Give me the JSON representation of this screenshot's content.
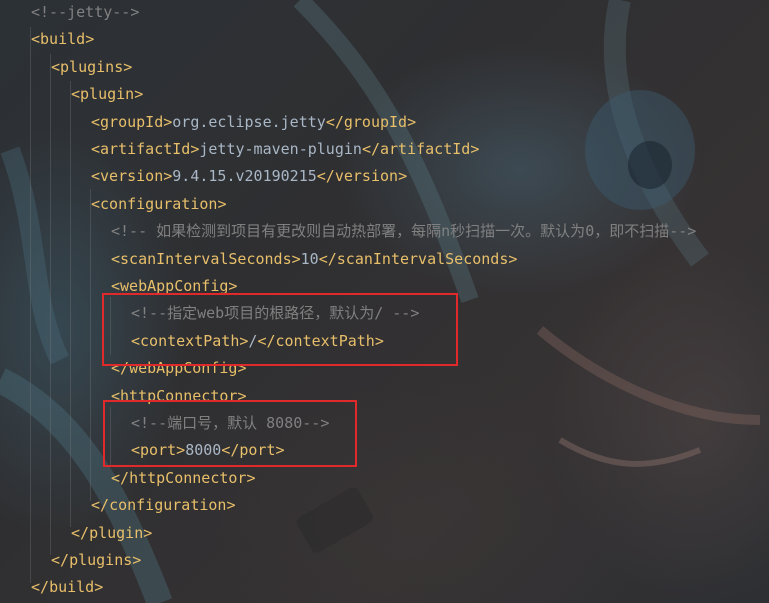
{
  "editor": {
    "lines": [
      {
        "kind": "comment",
        "text": "<!--jetty-->"
      },
      {
        "kind": "open",
        "tag": "build"
      },
      {
        "kind": "open",
        "tag": "plugins"
      },
      {
        "kind": "open",
        "tag": "plugin"
      },
      {
        "kind": "elem",
        "tag": "groupId",
        "value": "org.eclipse.jetty"
      },
      {
        "kind": "elem",
        "tag": "artifactId",
        "value": "jetty-maven-plugin"
      },
      {
        "kind": "elem",
        "tag": "version",
        "value": "9.4.15.v20190215"
      },
      {
        "kind": "open",
        "tag": "configuration"
      },
      {
        "kind": "comment",
        "text": "<!-- 如果检测到项目有更改则自动热部署，每隔n秒扫描一次。默认为0，即不扫描-->"
      },
      {
        "kind": "elem",
        "tag": "scanIntervalSeconds",
        "value": "10"
      },
      {
        "kind": "open",
        "tag": "webAppConfig"
      },
      {
        "kind": "comment",
        "text": "<!--指定web项目的根路径，默认为/ -->"
      },
      {
        "kind": "elem",
        "tag": "contextPath",
        "value": "/"
      },
      {
        "kind": "close",
        "tag": "webAppConfig"
      },
      {
        "kind": "open",
        "tag": "httpConnector"
      },
      {
        "kind": "comment",
        "text": "<!--端口号，默认 8080-->"
      },
      {
        "kind": "elem",
        "tag": "port",
        "value": "8000"
      },
      {
        "kind": "close",
        "tag": "httpConnector"
      },
      {
        "kind": "close",
        "tag": "configuration"
      },
      {
        "kind": "close",
        "tag": "plugin"
      },
      {
        "kind": "close",
        "tag": "plugins"
      },
      {
        "kind": "close",
        "tag": "build"
      }
    ],
    "highlights": [
      "webAppConfig-contextPath",
      "port-setting"
    ]
  },
  "colors": {
    "tag": "#e8bf6a",
    "text": "#a9b7c6",
    "comment": "#808080",
    "highlight_border": "#e0292b"
  }
}
